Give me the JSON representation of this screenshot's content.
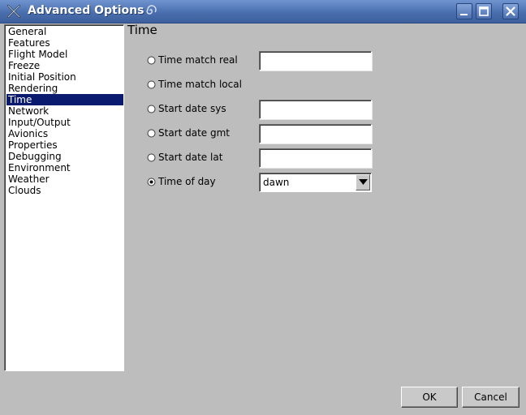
{
  "window": {
    "title": "Advanced Options"
  },
  "sidebar": {
    "items": [
      {
        "label": "General"
      },
      {
        "label": "Features"
      },
      {
        "label": "Flight Model"
      },
      {
        "label": "Freeze"
      },
      {
        "label": "Initial Position"
      },
      {
        "label": "Rendering"
      },
      {
        "label": "Time",
        "selected": true
      },
      {
        "label": "Network"
      },
      {
        "label": "Input/Output"
      },
      {
        "label": "Avionics"
      },
      {
        "label": "Properties"
      },
      {
        "label": "Debugging"
      },
      {
        "label": "Environment"
      },
      {
        "label": "Weather"
      },
      {
        "label": "Clouds"
      }
    ]
  },
  "main": {
    "title": "Time",
    "options": [
      {
        "label": "Time match real",
        "has_field": true,
        "value": "",
        "selected": false
      },
      {
        "label": "Time match local",
        "has_field": false,
        "selected": false
      },
      {
        "label": "Start date sys",
        "has_field": true,
        "value": "",
        "selected": false
      },
      {
        "label": "Start date gmt",
        "has_field": true,
        "value": "",
        "selected": false
      },
      {
        "label": "Start date lat",
        "has_field": true,
        "value": "",
        "selected": false
      },
      {
        "label": "Time of day",
        "has_field": false,
        "selected": true
      }
    ],
    "time_of_day_value": "dawn"
  },
  "buttons": {
    "ok": "OK",
    "cancel": "Cancel"
  },
  "colors": {
    "title_bar": "#4a6fae",
    "selection": "#0a1a6e",
    "dialog_bg": "#bdbdbd"
  }
}
